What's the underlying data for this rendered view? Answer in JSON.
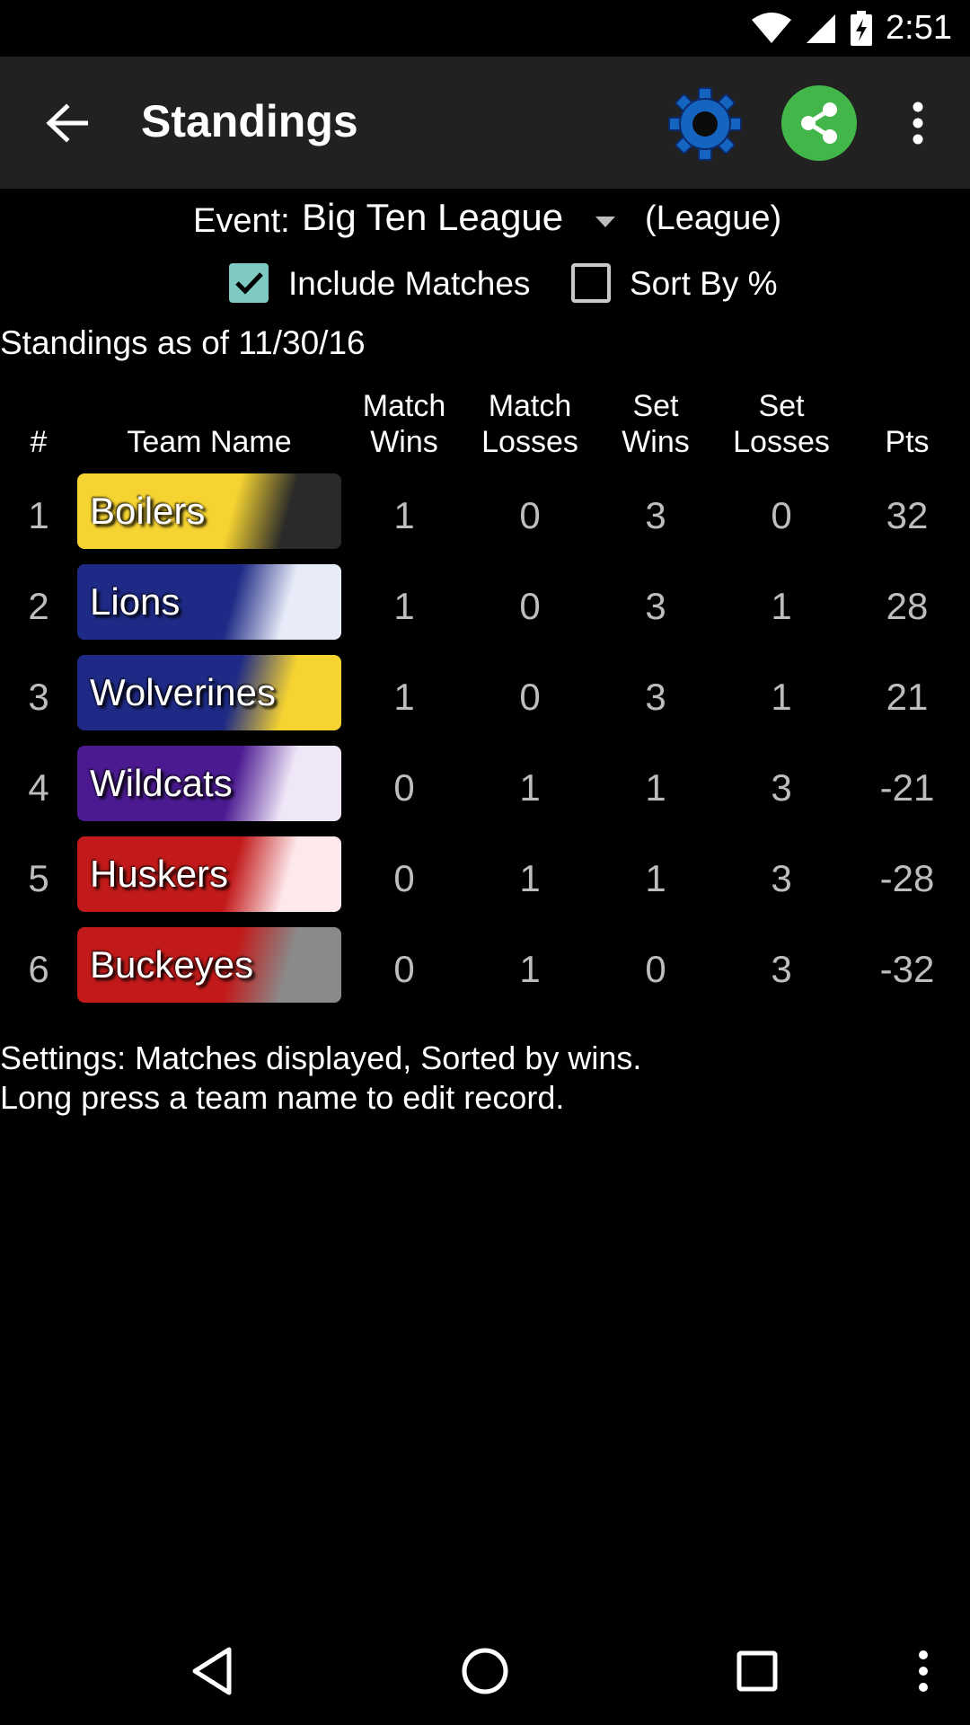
{
  "status": {
    "time": "2:51"
  },
  "toolbar": {
    "title": "Standings"
  },
  "event": {
    "label": "Event:",
    "value": "Big Ten League",
    "type": "(League)"
  },
  "options": {
    "include_matches": "Include Matches",
    "sort_by_pct": "Sort By %",
    "include_matches_checked": true,
    "sort_by_pct_checked": false
  },
  "asof": "Standings as of 11/30/16",
  "table": {
    "headers": {
      "rank": "#",
      "team": "Team Name",
      "match_wins_1": "Match",
      "match_wins_2": "Wins",
      "match_losses_1": "Match",
      "match_losses_2": "Losses",
      "set_wins_1": "Set",
      "set_wins_2": "Wins",
      "set_losses_1": "Set",
      "set_losses_2": "Losses",
      "pts": "Pts"
    },
    "rows": [
      {
        "rank": "1",
        "team": "Boilers",
        "colors": [
          "#f5d331",
          "#2a2a2a"
        ],
        "match_wins": "1",
        "match_losses": "0",
        "set_wins": "3",
        "set_losses": "0",
        "pts": "32"
      },
      {
        "rank": "2",
        "team": "Lions",
        "colors": [
          "#1e2a85",
          "#e8ecf8"
        ],
        "match_wins": "1",
        "match_losses": "0",
        "set_wins": "3",
        "set_losses": "1",
        "pts": "28"
      },
      {
        "rank": "3",
        "team": "Wolverines",
        "colors": [
          "#1e2a85",
          "#f5d331"
        ],
        "match_wins": "1",
        "match_losses": "0",
        "set_wins": "3",
        "set_losses": "1",
        "pts": "21"
      },
      {
        "rank": "4",
        "team": "Wildcats",
        "colors": [
          "#4b1a91",
          "#efe6f7"
        ],
        "match_wins": "0",
        "match_losses": "1",
        "set_wins": "1",
        "set_losses": "3",
        "pts": "-21"
      },
      {
        "rank": "5",
        "team": "Huskers",
        "colors": [
          "#c21a1a",
          "#fde9ec"
        ],
        "match_wins": "0",
        "match_losses": "1",
        "set_wins": "1",
        "set_losses": "3",
        "pts": "-28"
      },
      {
        "rank": "6",
        "team": "Buckeyes",
        "colors": [
          "#c21a1a",
          "#8a8a8a"
        ],
        "match_wins": "0",
        "match_losses": "1",
        "set_wins": "0",
        "set_losses": "3",
        "pts": "-32"
      }
    ]
  },
  "notes": {
    "line1": "Settings: Matches displayed, Sorted by wins.",
    "line2": "Long press a team name to edit record."
  },
  "colors": {
    "toolbar": "#212121",
    "share": "#43b649",
    "checkbox": "#7ec9c1",
    "gear": "#1565c0"
  },
  "icons": {
    "back": "arrow-back-icon",
    "gear": "gear-icon",
    "share": "share-icon",
    "overflow": "more-vert-icon"
  }
}
